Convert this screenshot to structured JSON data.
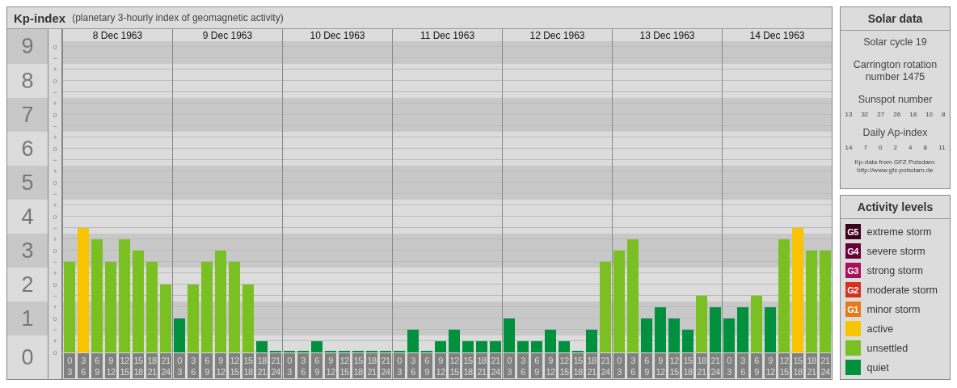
{
  "header": {
    "title": "Kp-index",
    "subtitle": "(planetary 3-hourly index of geomagnetic activity)"
  },
  "y_minor_marks": [
    "o",
    "−",
    "+",
    "o",
    "−",
    "+",
    "o",
    "−",
    "+",
    "o",
    "−",
    "+",
    "o",
    "−",
    "+",
    "o",
    "−",
    "+",
    "o",
    "−",
    "+",
    "o",
    "−",
    "+",
    "o",
    "−",
    "+",
    "o"
  ],
  "days": [
    {
      "date": "8 Dec 1963"
    },
    {
      "date": "9 Dec 1963"
    },
    {
      "date": "10 Dec 1963"
    },
    {
      "date": "11 Dec 1963"
    },
    {
      "date": "12 Dec 1963"
    },
    {
      "date": "13 Dec 1963"
    },
    {
      "date": "14 Dec 1963"
    }
  ],
  "chart_data": {
    "type": "bar",
    "grid": true,
    "ylim": [
      0,
      9
    ],
    "yticks": [
      {
        "value": 0,
        "label": "0"
      },
      {
        "value": 1,
        "label": "1"
      },
      {
        "value": 2,
        "label": "2"
      },
      {
        "value": 3,
        "label": "3"
      },
      {
        "value": 4,
        "label": "4"
      },
      {
        "value": 5,
        "label": "5"
      },
      {
        "value": 6,
        "label": "6"
      },
      {
        "value": 7,
        "label": "7"
      },
      {
        "value": 8,
        "label": "8"
      },
      {
        "value": 9,
        "label": "9"
      }
    ],
    "categories": [
      "0 3",
      "3 6",
      "6 9",
      "9 12",
      "12 15",
      "15 18",
      "18 21",
      "21 24",
      "0 3",
      "3 6",
      "6 9",
      "9 12",
      "12 15",
      "15 18",
      "18 21",
      "21 24",
      "0 3",
      "3 6",
      "6 9",
      "9 12",
      "12 15",
      "15 18",
      "18 21",
      "21 24",
      "0 3",
      "3 6",
      "6 9",
      "9 12",
      "12 15",
      "15 18",
      "18 21",
      "21 24",
      "0 3",
      "3 6",
      "6 9",
      "9 12",
      "12 15",
      "15 18",
      "18 21",
      "21 24",
      "0 3",
      "3 6",
      "6 9",
      "9 12",
      "12 15",
      "15 18",
      "18 21",
      "21 24",
      "0 3",
      "3 6",
      "6 9",
      "9 12",
      "12 15",
      "15 18",
      "18 21",
      "21 24"
    ],
    "values": [
      2.67,
      3.67,
      3.33,
      2.67,
      3.33,
      3,
      2.67,
      2,
      1,
      2,
      2.67,
      3,
      2.67,
      2,
      0.33,
      0,
      0,
      0,
      0.33,
      0,
      0,
      0,
      0,
      0,
      0,
      0.67,
      0,
      0.33,
      0.67,
      0.33,
      0.33,
      0.33,
      1,
      0.33,
      0.33,
      0.67,
      0.33,
      0,
      0.67,
      2.67,
      3,
      3.33,
      1,
      1.33,
      1,
      0.67,
      1.67,
      1.33,
      1,
      1.33,
      1.67,
      1.33,
      3.33,
      3.67,
      3,
      3
    ]
  },
  "solar_data": {
    "title": "Solar data",
    "solar_cycle": "Solar cycle 19",
    "carrington": "Carrington rotation number 1475",
    "sunspot_title": "Sunspot number",
    "sunspot_values": [
      "13",
      "32",
      "27",
      "26",
      "18",
      "10",
      "8"
    ],
    "ap_title": "Daily Ap-index",
    "ap_values": [
      "14",
      "7",
      "0",
      "2",
      "4",
      "8",
      "11"
    ],
    "source": "Kp-data from GFZ Potsdam:",
    "source_url": "http://www.gfz-potsdam.de"
  },
  "activity_levels": {
    "title": "Activity levels",
    "items": [
      {
        "badge": "G5",
        "label": "extreme storm",
        "color": "#3c0020"
      },
      {
        "badge": "G4",
        "label": "severe storm",
        "color": "#6a0038"
      },
      {
        "badge": "G3",
        "label": "strong storm",
        "color": "#a8105c"
      },
      {
        "badge": "G2",
        "label": "moderate storm",
        "color": "#d83020"
      },
      {
        "badge": "G1",
        "label": "minor storm",
        "color": "#e87818"
      },
      {
        "label": "active",
        "color": "#f8c400"
      },
      {
        "label": "unsettled",
        "color": "#7ac022"
      },
      {
        "label": "quiet",
        "color": "#00903e"
      }
    ]
  }
}
